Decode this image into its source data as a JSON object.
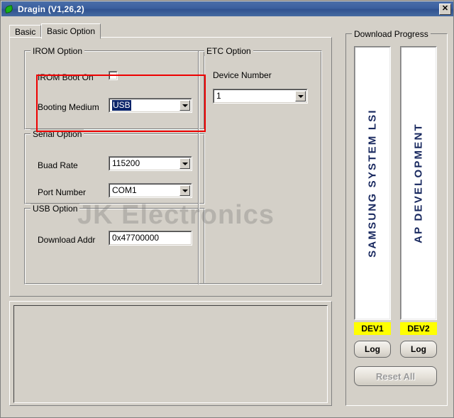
{
  "window": {
    "title": "Dragin (V1,26,2)",
    "icon": "green-leaf-icon",
    "close_label": "✕"
  },
  "tabs": [
    {
      "label": "Basic",
      "active": false
    },
    {
      "label": "Basic Option",
      "active": true
    }
  ],
  "irom_option": {
    "title": "IROM Option",
    "boot_on_label": "IROM Boot On",
    "boot_on_checked": false,
    "booting_medium_label": "Booting Medium",
    "booting_medium_value": "USB",
    "highlight_color": "#ee0000"
  },
  "serial_option": {
    "title": "Serial Option",
    "baud_rate_label": "Buad Rate",
    "baud_rate_value": "115200",
    "port_number_label": "Port Number",
    "port_number_value": "COM1"
  },
  "usb_option": {
    "title": "USB Option",
    "download_addr_label": "Download Addr",
    "download_addr_value": "0x47700000"
  },
  "etc_option": {
    "title": "ETC Option",
    "device_number_label": "Device Number",
    "device_number_value": "1"
  },
  "download_progress": {
    "title": "Download Progress",
    "bars": [
      {
        "text": "SAMSUNG SYSTEM LSI",
        "badge": "DEV1",
        "log_button": "Log",
        "badge_color": "#ffff00",
        "text_color": "#17275e"
      },
      {
        "text": "AP DEVELOPMENT",
        "badge": "DEV2",
        "log_button": "Log",
        "badge_color": "#ffff00",
        "text_color": "#17275e"
      }
    ],
    "reset_all_label": "Reset All",
    "reset_all_enabled": false
  },
  "log_panel": {
    "content": "",
    "scroll_up_icon": "triangle-up-icon",
    "scroll_down_icon": "triangle-down-icon"
  },
  "watermark": {
    "text": "JK Electronics"
  }
}
